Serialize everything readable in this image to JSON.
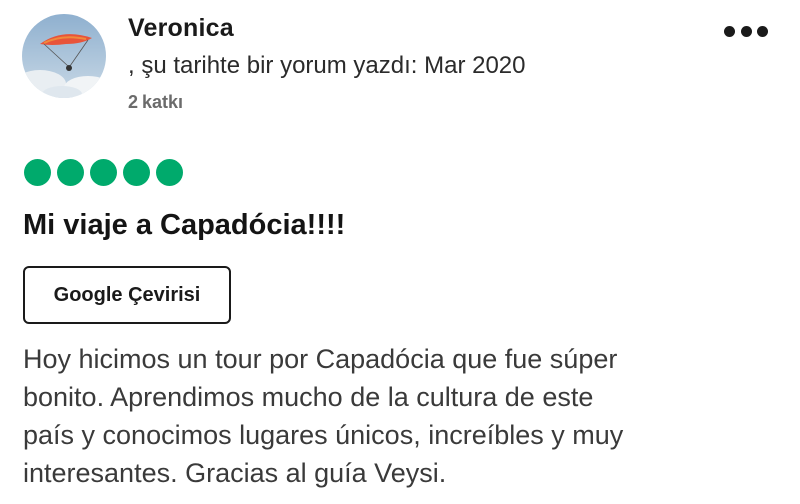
{
  "author": {
    "name": "Veronica",
    "review_meta": ", şu tarihte bir yorum yazdı: Mar 2020",
    "contributions_count": "2",
    "contributions_label": "katkı"
  },
  "review": {
    "rating": 5,
    "rating_max": 5,
    "title": "Mi viaje a Capadócia!!!!",
    "translate_label": "Google Çevirisi",
    "body_lines": [
      "Hoy hicimos un tour por Capadócia que fue súper",
      "bonito. Aprendimos mucho de la cultura de este",
      "país y conocimos lugares únicos, increíbles y muy",
      "interesantes. Gracias al guía Veysi."
    ]
  },
  "icons": {
    "more": "more-options-icon",
    "rating": "rating-bubble-icon"
  },
  "colors": {
    "rating_green": "#00aa6c",
    "text_primary": "#1a1a1a",
    "text_secondary": "#6b6b6b"
  }
}
